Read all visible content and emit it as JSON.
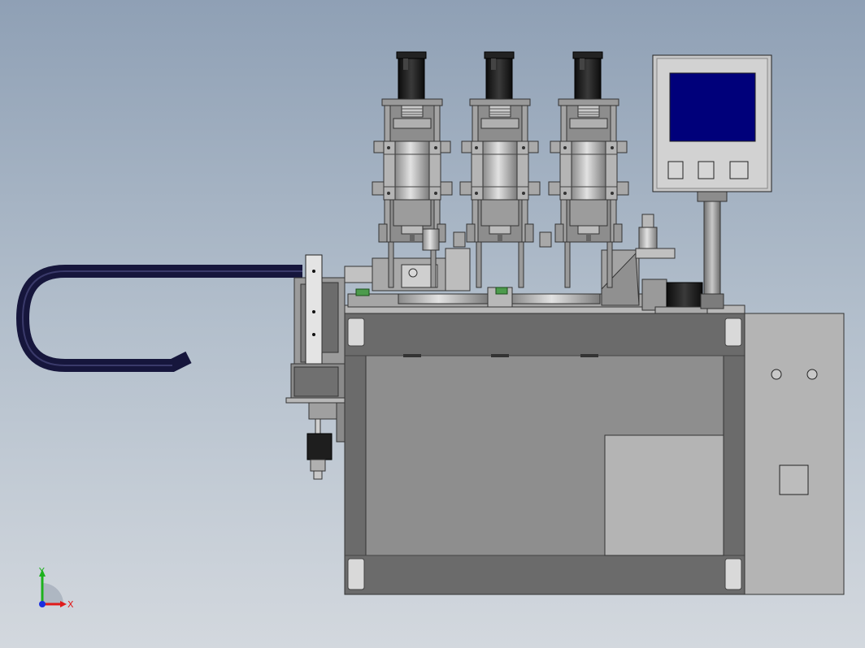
{
  "viewport": {
    "background_top": "#8fa0b5",
    "background_bottom": "#d3d8de"
  },
  "model": {
    "frame_color": "#6b6b6b",
    "panel_color": "#8e8e8e",
    "cabinet_color": "#b4b4b4",
    "hmi_screen_color": "#00007a",
    "cable_chain_color": "#16163c",
    "hmi_buttons": [
      "button-1",
      "button-2",
      "button-3"
    ],
    "spindle_units": [
      "spindle-1",
      "spindle-2",
      "spindle-3"
    ]
  },
  "triad": {
    "y_label": "Y",
    "x_label": "X",
    "y_color": "#1db11d",
    "x_color": "#e01a1a",
    "z_color": "#1a2ee0"
  }
}
